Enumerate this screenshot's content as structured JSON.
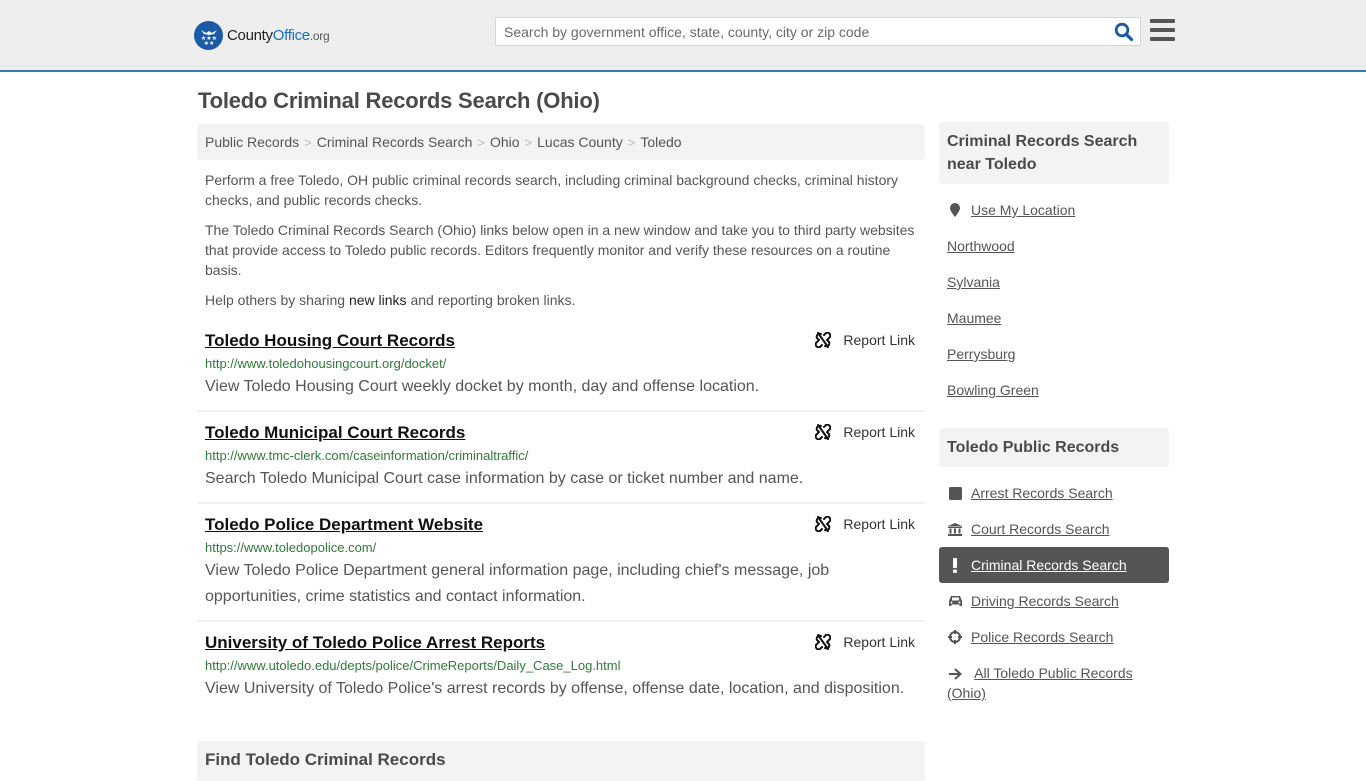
{
  "header": {
    "logo": {
      "county": "County",
      "office": "Office",
      "org": ".org"
    },
    "search_placeholder": "Search by government office, state, county, city or zip code",
    "search_value": ""
  },
  "page": {
    "title": "Toledo Criminal Records Search (Ohio)"
  },
  "breadcrumb": [
    {
      "label": "Public Records"
    },
    {
      "label": "Criminal Records Search"
    },
    {
      "label": "Ohio"
    },
    {
      "label": "Lucas County"
    },
    {
      "label": "Toledo"
    }
  ],
  "intro": {
    "p1": "Perform a free Toledo, OH public criminal records search, including criminal background checks, criminal history checks, and public records checks.",
    "p2": "The Toledo Criminal Records Search (Ohio) links below open in a new window and take you to third party websites that provide access to Toledo public records. Editors frequently monitor and verify these resources on a routine basis.",
    "p3_before": "Help others by sharing ",
    "p3_link": "new links",
    "p3_after": " and reporting broken links."
  },
  "report_label": "Report Link",
  "results": [
    {
      "title": "Toledo Housing Court Records",
      "url": "http://www.toledohousingcourt.org/docket/",
      "desc": "View Toledo Housing Court weekly docket by month, day and offense location."
    },
    {
      "title": "Toledo Municipal Court Records",
      "url": "http://www.tmc-clerk.com/caseinformation/criminaltraffic/",
      "desc": "Search Toledo Municipal Court case information by case or ticket number and name."
    },
    {
      "title": "Toledo Police Department Website",
      "url": "https://www.toledopolice.com/",
      "desc": "View Toledo Police Department general information page, including chief's message, job opportunities, crime statistics and contact information."
    },
    {
      "title": "University of Toledo Police Arrest Reports",
      "url": "http://www.utoledo.edu/depts/police/CrimeReports/Daily_Case_Log.html",
      "desc": "View University of Toledo Police's arrest records by offense, offense date, location, and disposition."
    }
  ],
  "find_box": {
    "title": "Find Toledo Criminal Records"
  },
  "sidebar": {
    "nearby": {
      "title": "Criminal Records Search near Toledo",
      "use_location": "Use My Location",
      "cities": [
        "Northwood",
        "Sylvania",
        "Maumee",
        "Perrysburg",
        "Bowling Green"
      ]
    },
    "public_records": {
      "title": "Toledo Public Records",
      "items": [
        {
          "label": "Arrest Records Search",
          "icon": "square-icon",
          "active": false
        },
        {
          "label": "Court Records Search",
          "icon": "courthouse-icon",
          "active": false
        },
        {
          "label": "Criminal Records Search",
          "icon": "exclamation-icon",
          "active": true
        },
        {
          "label": "Driving Records Search",
          "icon": "car-icon",
          "active": false
        },
        {
          "label": "Police Records Search",
          "icon": "crosshairs-icon",
          "active": false
        },
        {
          "label": "All Toledo Public Records (Ohio)",
          "icon": "arrow-right-icon",
          "active": false
        }
      ]
    }
  },
  "colors": {
    "brand_blue": "#1a5aa6",
    "header_border": "#3b7bb0",
    "url_green": "#2f7a3a",
    "active_bg": "#555555"
  }
}
